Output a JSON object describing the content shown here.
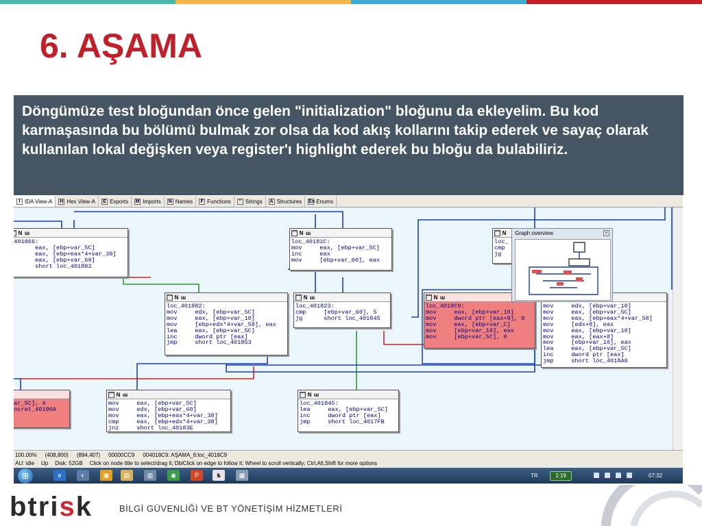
{
  "slide": {
    "title": "6. AŞAMA",
    "body": "Döngümüze test bloğundan önce gelen \"initialization\" bloğunu da ekleyelim. Bu kod karmaşasında bu bölümü bulmak zor olsa da kod akış kollarını takip ederek ve sayaç olarak kullanılan lokal değişken veya register'ı highlight ederek bu bloğu da bulabiliriz.",
    "top_colors": [
      "#4ab9a8",
      "#f2b84b",
      "#3fa9d6",
      "#c0202a"
    ]
  },
  "tabs": [
    {
      "label": "IDA View-A",
      "icon": "I"
    },
    {
      "label": "Hex View-A",
      "icon": "H"
    },
    {
      "label": "Exports",
      "icon": "E"
    },
    {
      "label": "Imports",
      "icon": "M"
    },
    {
      "label": "Names",
      "icon": "N"
    },
    {
      "label": "Functions",
      "icon": "F"
    },
    {
      "label": "Strings",
      "icon": "\""
    },
    {
      "label": "Structures",
      "icon": "A"
    },
    {
      "label": "Enums",
      "icon": "En"
    }
  ],
  "node_icons": {
    "a": "▦",
    "b": "N",
    "c": "ɯ"
  },
  "nodes": [
    {
      "lines": [
        "_401866:",
        "v      eax, [ebp+var_5C]",
        "v      eax, [ebp+eax*4+var_38]",
        "v      eax, [ebp+var_60]",
        "p      short loc_401882"
      ]
    },
    {
      "lines": [
        "loc_40181C:",
        "mov     eax, [ebp+var_5C]",
        "inc     eax",
        "mov     [ebp+var_60], eax"
      ]
    },
    {
      "lines": [
        "loc_",
        "cmp",
        "jg"
      ]
    },
    {
      "lines": [
        "loc_401882:",
        "mov     edx, [ebp+var_5C]",
        "mov     eax, [ebp+var_10]",
        "mov     [ebp+edx*4+var_58], eax",
        "lea     eax, [ebp+var_5C]",
        "inc     dword ptr [eax]",
        "jmp     short loc_401853"
      ]
    },
    {
      "lines": [
        "loc_401823:",
        "cmp     [ebp+var_60], 5",
        "jg      short loc_401845"
      ]
    },
    {
      "lines": [
        "loc_4018C9:",
        "mov     eax, [ebp+var_10]",
        "mov     dword ptr [eax+8], 0",
        "mov     eax, [ebp+var_C]",
        "mov     [ebp+var_10], eax",
        "mov     [ebp+var_5C], 0"
      ]
    },
    {
      "lines": [
        "mov     edx, [ebp+var_10]",
        "mov     eax, [ebp+var_5C]",
        "mov     eax, [ebp+eax*4+var_58]",
        "mov     [edx+8], eax",
        "mov     eax, [ebp+var_10]",
        "mov     eax, [eax+8]",
        "mov     [ebp+var_10], eax",
        "lea     eax, [ebp+var_5C]",
        "inc     dword ptr [eax]",
        "jmp     short loc_4018A6"
      ]
    },
    {
      "lines": [
        "",
        "",
        "var_5C], 4",
        "locret_40190A"
      ]
    },
    {
      "lines": [
        "mov     eax, [ebp+var_5C]",
        "mov     edx, [ebp+var_60]",
        "mov     eax, [ebp+eax*4+var_38]",
        "cmp     eax, [ebp+edx*4+var_38]",
        "jnz     short loc_40183E"
      ]
    },
    {
      "lines": [
        "",
        "loc_401845:",
        "lea     eax, [ebp+var_5C]",
        "inc     dword ptr [eax]",
        "jmp     short loc_4017FB"
      ]
    }
  ],
  "overview": {
    "title": "Graph overview",
    "close": "×"
  },
  "status": {
    "zoom": "100.00%",
    "pos1": "(408,800)",
    "pos2": "(894,407)",
    "offset": "00000CC9",
    "location": "004018C9: AŞAMA_6:loc_4018C9"
  },
  "hint": {
    "state": "AU:  idle",
    "dir": "Up",
    "disk": "Disk: 52GB",
    "message": "Click on node title to select/drag it; DblClick on edge to follow it; Wheel to scroll vertically; Ctrl,Alt,Shift for more options"
  },
  "taskbar": {
    "lang": "TR",
    "battery": "1:19",
    "clock": "07:32",
    "apps": [
      "e",
      "◐",
      "▣",
      "▤",
      "▥",
      "◉",
      "P",
      "♞",
      "▦"
    ]
  },
  "footer": {
    "logo_a": "btri",
    "logo_b": "s",
    "logo_c": "k",
    "tagline": "BİLGİ GÜVENLİĞİ VE BT YÖNETİŞİM HİZMETLERİ"
  }
}
